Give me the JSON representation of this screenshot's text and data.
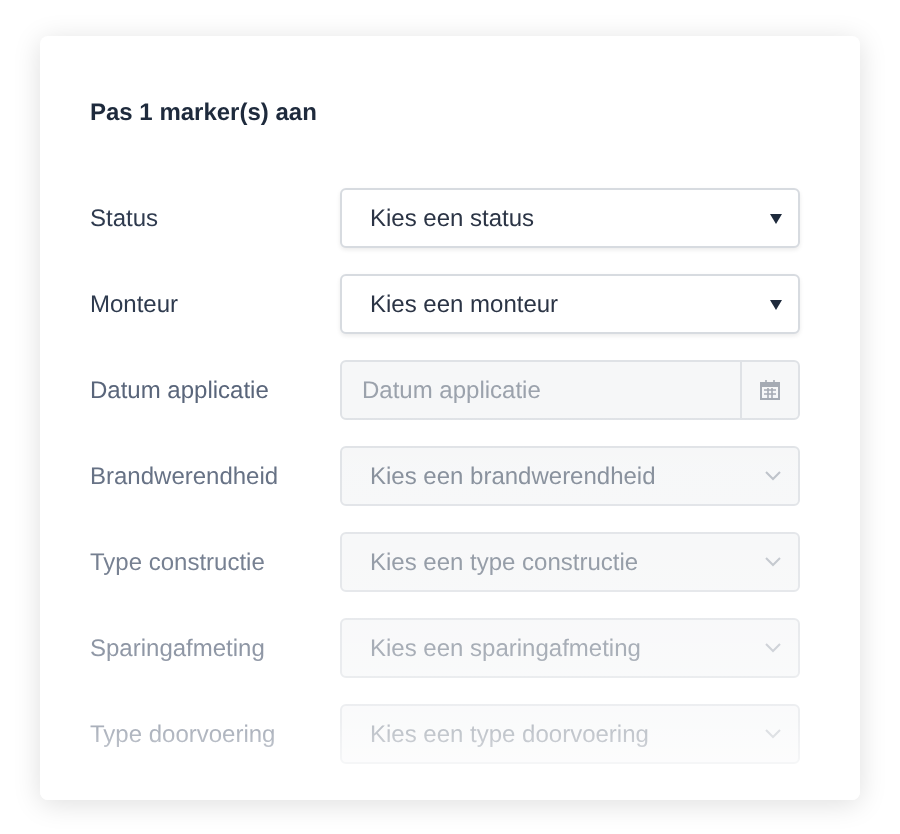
{
  "title": "Pas 1 marker(s) aan",
  "fields": [
    {
      "kind": "select",
      "label": "Status",
      "placeholder": "Kies een status",
      "disabled": false
    },
    {
      "kind": "select",
      "label": "Monteur",
      "placeholder": "Kies een monteur",
      "disabled": false
    },
    {
      "kind": "date",
      "label": "Datum applicatie",
      "placeholder": "Datum applicatie",
      "disabled": true
    },
    {
      "kind": "select",
      "label": "Brandwerendheid",
      "placeholder": "Kies een brandwerendheid",
      "disabled": true
    },
    {
      "kind": "select",
      "label": "Type constructie",
      "placeholder": "Kies een type constructie",
      "disabled": true
    },
    {
      "kind": "select",
      "label": "Sparingafmeting",
      "placeholder": "Kies een sparingafmeting",
      "disabled": true
    },
    {
      "kind": "select",
      "label": "Type doorvoering",
      "placeholder": "Kies een type doorvoering",
      "disabled": true
    }
  ]
}
